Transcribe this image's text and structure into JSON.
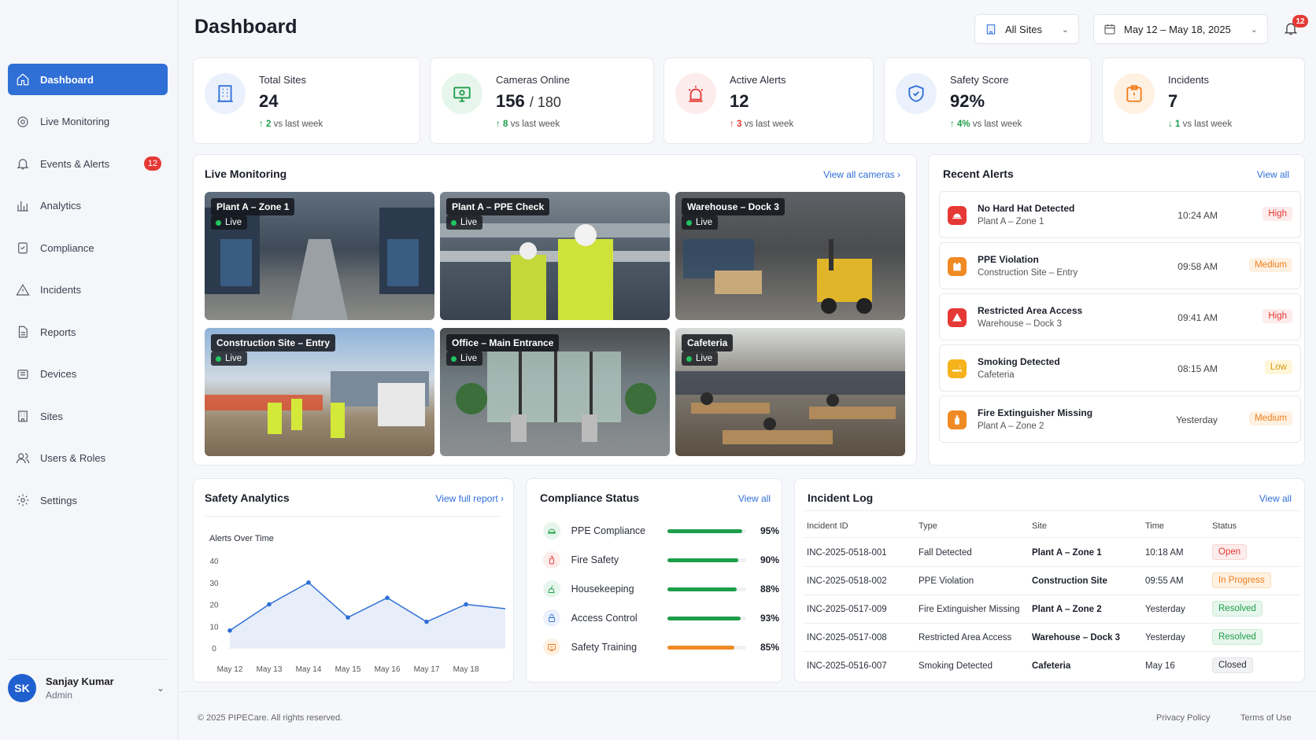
{
  "header": {
    "title": "Dashboard",
    "sites_select": "All Sites",
    "date_range": "May 12 –  May 18, 2025",
    "notif_count": "12"
  },
  "sidebar": {
    "items": [
      {
        "label": "Dashboard"
      },
      {
        "label": "Live Monitoring"
      },
      {
        "label": "Events & Alerts",
        "badge": "12"
      },
      {
        "label": "Analytics"
      },
      {
        "label": "Compliance"
      },
      {
        "label": "Incidents"
      },
      {
        "label": "Reports"
      },
      {
        "label": "Devices"
      },
      {
        "label": "Sites"
      },
      {
        "label": "Users & Roles"
      },
      {
        "label": "Settings"
      }
    ],
    "user": {
      "initials": "SK",
      "name": "Sanjay Kumar",
      "role": "Admin"
    }
  },
  "stats": [
    {
      "label": "Total Sites",
      "value": "24",
      "delta": "2",
      "delta_text": "vs last week"
    },
    {
      "label": "Cameras Online",
      "value": "156",
      "value_suffix": "/ 180",
      "delta": "8",
      "delta_text": "vs last week"
    },
    {
      "label": "Active Alerts",
      "value": "12",
      "delta": "3",
      "delta_text": "vs last week"
    },
    {
      "label": "Safety Score",
      "value": "92%",
      "delta": "4%",
      "delta_text": "vs last week"
    },
    {
      "label": "Incidents",
      "value": "7",
      "delta": "1",
      "delta_text": "vs last week"
    }
  ],
  "live": {
    "title": "Live Monitoring",
    "link": "View all cameras",
    "cameras": [
      {
        "name": "Plant A – Zone 1",
        "status": "Live"
      },
      {
        "name": "Plant A – PPE Check",
        "status": "Live"
      },
      {
        "name": "Warehouse – Dock 3",
        "status": "Live"
      },
      {
        "name": "Construction Site – Entry",
        "status": "Live"
      },
      {
        "name": "Office – Main Entrance",
        "status": "Live"
      },
      {
        "name": "Cafeteria",
        "status": "Live"
      }
    ]
  },
  "alerts": {
    "title": "Recent Alerts",
    "link": "View all",
    "items": [
      {
        "title": "No Hard Hat Detected",
        "site": "Plant A – Zone 1",
        "time": "10:24 AM",
        "severity": "High"
      },
      {
        "title": "PPE Violation",
        "site": "Construction Site – Entry",
        "time": "09:58 AM",
        "severity": "Medium"
      },
      {
        "title": "Restricted Area Access",
        "site": "Warehouse – Dock 3",
        "time": "09:41 AM",
        "severity": "High"
      },
      {
        "title": "Smoking Detected",
        "site": "Cafeteria",
        "time": "08:15 AM",
        "severity": "Low"
      },
      {
        "title": "Fire Extinguisher Missing",
        "site": "Plant A – Zone 2",
        "time": "Yesterday",
        "severity": "Medium"
      }
    ]
  },
  "analytics": {
    "title": "Safety Analytics",
    "link": "View full report",
    "chart_data": {
      "type": "area",
      "title": "Alerts Over Time",
      "x": [
        "May 12",
        "May 13",
        "May 14",
        "May 15",
        "May 16",
        "May 17",
        "May 18"
      ],
      "yticks": [
        "0",
        "10",
        "20",
        "30",
        "40"
      ],
      "ylim": [
        0,
        40
      ],
      "series": [
        {
          "values": [
            8,
            20,
            30,
            14,
            23,
            12,
            20,
            18
          ],
          "color": "#2f6fd6"
        }
      ]
    }
  },
  "compliance": {
    "title": "Compliance Status",
    "link": "View all",
    "items": [
      {
        "label": "PPE Compliance",
        "pct": "95%",
        "value": 95,
        "color": "#1e9e4a"
      },
      {
        "label": "Fire Safety",
        "pct": "90%",
        "value": 90,
        "color": "#1e9e4a"
      },
      {
        "label": "Housekeeping",
        "pct": "88%",
        "value": 88,
        "color": "#1e9e4a"
      },
      {
        "label": "Access Control",
        "pct": "93%",
        "value": 93,
        "color": "#1e9e4a"
      },
      {
        "label": "Safety Training",
        "pct": "85%",
        "value": 85,
        "color": "#f08a24"
      }
    ]
  },
  "incidents": {
    "title": "Incident Log",
    "link": "View all",
    "headers": [
      "Incident ID",
      "Type",
      "Site",
      "Time",
      "Status"
    ],
    "rows": [
      {
        "id": "INC-2025-0518-001",
        "type": "Fall Detected",
        "site": "Plant A – Zone 1",
        "time": "10:18 AM",
        "status": "Open"
      },
      {
        "id": "INC-2025-0518-002",
        "type": "PPE Violation",
        "site": "Construction Site",
        "time": "09:55 AM",
        "status": "In Progress"
      },
      {
        "id": "INC-2025-0517-009",
        "type": "Fire Extinguisher Missing",
        "site": "Plant A – Zone 2",
        "time": "Yesterday",
        "status": "Resolved"
      },
      {
        "id": "INC-2025-0517-008",
        "type": "Restricted Area Access",
        "site": "Warehouse – Dock 3",
        "time": "Yesterday",
        "status": "Resolved"
      },
      {
        "id": "INC-2025-0516-007",
        "type": "Smoking Detected",
        "site": "Cafeteria",
        "time": "May 16",
        "status": "Closed"
      }
    ]
  },
  "footer": {
    "copyright": "© 2025 PIPECare. All rights reserved.",
    "privacy": "Privacy Policy",
    "terms": "Terms of Use"
  }
}
